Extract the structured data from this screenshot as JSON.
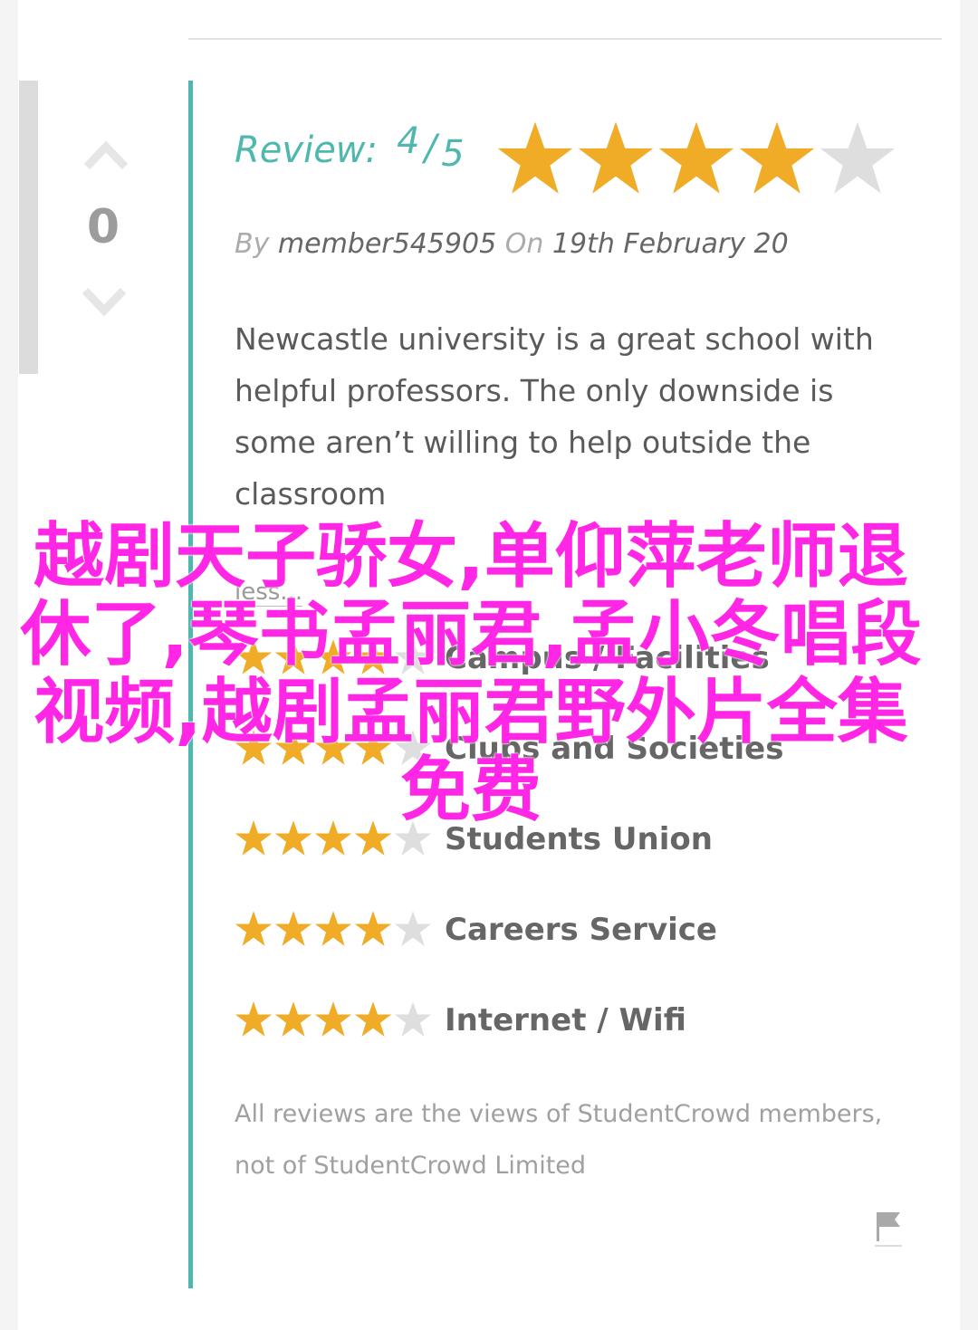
{
  "vote": {
    "count": "0"
  },
  "review": {
    "label": "Review:",
    "score": "4",
    "slash": "/",
    "out_of": "5",
    "rating": 4,
    "max_rating": 5,
    "by_label": "By",
    "author": "member545905",
    "on_label": "On",
    "date": "19th February 20",
    "body": "Newcastle university is a great school with helpful professors. The only downside is some aren’t willing to help outside the classroom",
    "less_link": "less..."
  },
  "categories": [
    {
      "label": "Campus / Facilities",
      "rating": 4
    },
    {
      "label": "Clubs and Societies",
      "rating": 4
    },
    {
      "label": "Students Union",
      "rating": 4
    },
    {
      "label": "Careers Service",
      "rating": 4
    },
    {
      "label": "Internet / Wifi",
      "rating": 4
    }
  ],
  "disclaimer": "All reviews are the views of StudentCrowd members, not of StudentCrowd Limited",
  "overlay_text": "越剧天子骄女,单仰萍老师退休了,琴书孟丽君,孟小冬唱段视频,越剧孟丽君野外片全集免费",
  "colors": {
    "accent": "#4eb8ae",
    "star_filled": "#f0ac27",
    "star_empty": "#dedede",
    "overlay": "#ff26e6"
  },
  "icons": {
    "vote_up": "chevron-up-icon",
    "vote_down": "chevron-down-icon",
    "star": "star-icon",
    "flag": "flag-icon"
  }
}
